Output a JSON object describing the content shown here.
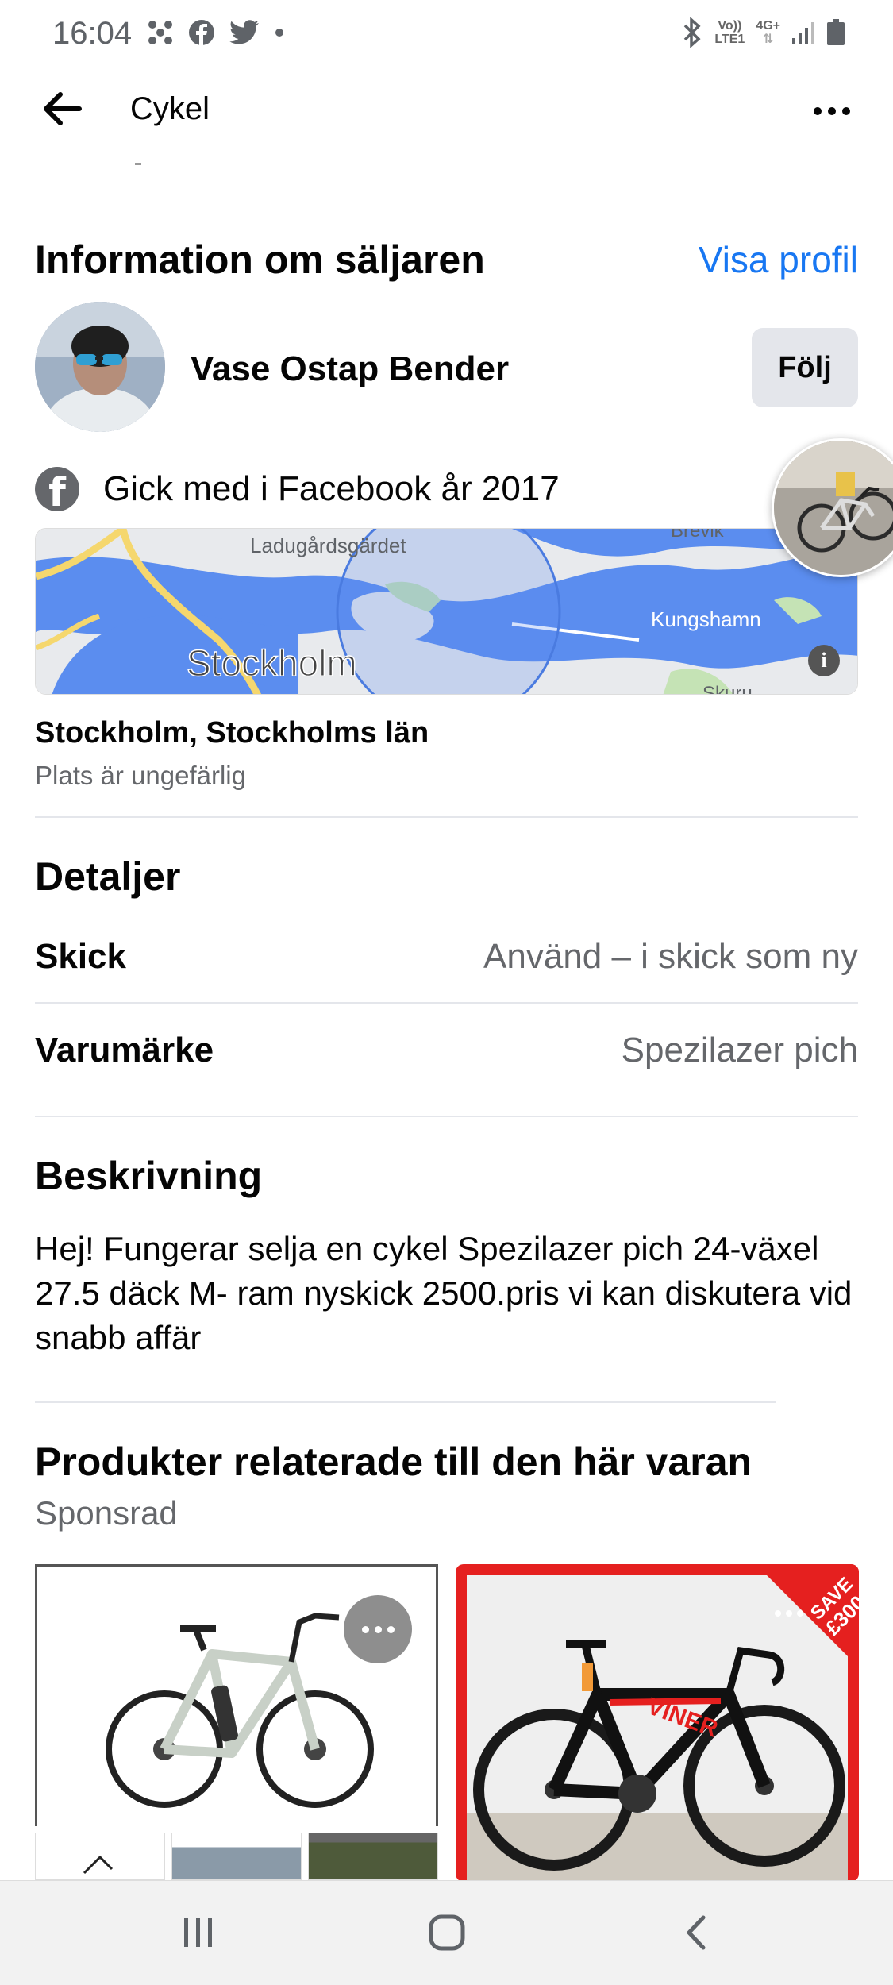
{
  "status_bar": {
    "time": "16:04",
    "network_top": "Vo))",
    "network_bottom": "LTE1",
    "network_type": "4G+"
  },
  "app_bar": {
    "title": "Cykel",
    "back_icon": "arrow-left-icon",
    "more_icon": "more-horizontal-icon"
  },
  "seller": {
    "heading": "Information om säljaren",
    "view_profile": "Visa profil",
    "name": "Vase Ostap Bender",
    "follow_label": "Följ",
    "joined": "Gick med i Facebook år 2017"
  },
  "map": {
    "labels": {
      "area1": "Ladugårdsgärdet",
      "area2": "Brevik",
      "area3": "Kungshamn",
      "city": "Stockholm",
      "area4": "Skuru"
    },
    "colors": {
      "water": "#5b8def",
      "land": "#e8eaed",
      "park": "#c5e3b5",
      "road": "#f5d76e"
    }
  },
  "location": {
    "name": "Stockholm, Stockholms län",
    "note": "Plats är ungefärlig"
  },
  "details": {
    "heading": "Detaljer",
    "rows": [
      {
        "label": "Skick",
        "value": "Använd – i skick som ny"
      },
      {
        "label": "Varumärke",
        "value": "Spezilazer pich"
      }
    ]
  },
  "description": {
    "heading": "Beskrivning",
    "text": "Hej! Fungerar selja en cykel Spezilazer pich 24-växel 27.5 däck  M- ram nyskick 2500.pris vi kan diskutera vid snabb affär"
  },
  "related": {
    "heading": "Produkter relaterade till den här varan",
    "sponsored": "Sponsrad",
    "card2_badge_top": "SAVE",
    "card2_badge_bottom": "£300",
    "card2_frame_name": "VINER"
  },
  "colors": {
    "accent": "#1877f2",
    "text_primary": "#050505",
    "text_secondary": "#65676b",
    "divider": "#e4e6eb",
    "promo_red": "#e5201f"
  }
}
